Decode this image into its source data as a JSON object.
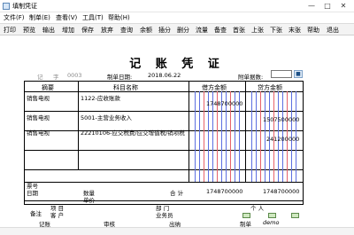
{
  "window": {
    "title": "填制凭证"
  },
  "menu": [
    "文件(F)",
    "制单(E)",
    "查看(V)",
    "工具(T)",
    "帮助(H)"
  ],
  "toolbar": [
    "打印",
    "预览",
    "输出",
    "增加",
    "保存",
    "放弃",
    "查询",
    "余额",
    "插分",
    "删分",
    "流量",
    "备查",
    "首张",
    "上张",
    "下张",
    "末张",
    "帮助",
    "退出"
  ],
  "voucher": {
    "title": "记 账 凭 证",
    "type_label": "记",
    "number_label": "字",
    "number": "0003",
    "date_label": "制单日期:",
    "date": "2018.06.22",
    "attach_label": "附单据数:"
  },
  "table": {
    "headers": {
      "summary": "摘要",
      "account": "科目名称",
      "debit": "借方金额",
      "credit": "贷方金额"
    },
    "rows": [
      {
        "summary": "销售电视",
        "account": "1122-应收账款",
        "debit": "1748700000",
        "credit": ""
      },
      {
        "summary": "销售电视",
        "account": "5001-主营业务收入",
        "debit": "",
        "credit": "1507500000"
      },
      {
        "summary": "销售电视",
        "account": "22210106-应交税费/应交增值税/销项税",
        "debit": "",
        "credit": "241200000"
      }
    ],
    "note": {
      "ticket_no": "票号",
      "date": "日期",
      "quantity": "数量",
      "unit_price": "单价"
    },
    "total": {
      "label": "合 计",
      "debit": "1748700000",
      "credit": "1748700000"
    },
    "memo": {
      "label": "备注",
      "project": "项 目",
      "department": "部 门",
      "individual": "个 人",
      "customer": "客 户",
      "salesperson": "业务员"
    }
  },
  "footer": {
    "bookkeeping": "记账",
    "audit": "审核",
    "cashier": "出纳",
    "maker": "制单",
    "maker_name": "demo"
  }
}
